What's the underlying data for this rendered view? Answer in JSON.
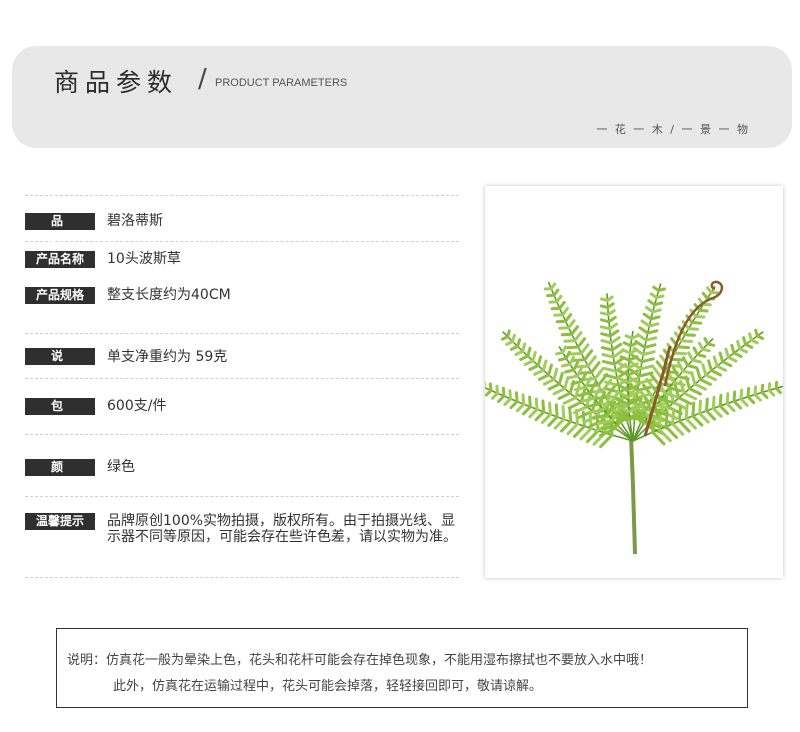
{
  "header": {
    "title_zh": "商品参数",
    "slash": "/",
    "title_en": "PRODUCT PARAMETERS",
    "tagline": "一 花 一 木 / 一 景 一 物"
  },
  "params": [
    {
      "label": "品 牌",
      "value": "碧洛蒂斯"
    },
    {
      "label": "产品名称",
      "value": "10头波斯草"
    },
    {
      "label": "产品规格",
      "value": "整支长度约为40CM"
    },
    {
      "label": "说 明",
      "value": "单支净重约为 59克"
    },
    {
      "label": "包 装",
      "value": "600支/件"
    },
    {
      "label": "颜 色",
      "value": "绿色"
    },
    {
      "label": "温馨提示",
      "value": "品牌原创100%实物拍摄，版权所有。由于拍摄光线、显示器不同等原因，可能会存在些许色差，请以实物为准。"
    }
  ],
  "product_image": {
    "subject": "fern-plant",
    "colors": {
      "leaf": "#8cbf3f",
      "leaf_dark": "#5e9a2a",
      "stem": "#7a9a4a",
      "frond_brown": "#8a5a2a"
    }
  },
  "note": {
    "line1": "说明：仿真花一般为晕染上色，花头和花杆可能会存在掉色现象，不能用湿布擦拭也不要放入水中哦！",
    "line2": "此外，仿真花在运输过程中，花头可能会掉落，轻轻接回即可，敬请谅解。"
  }
}
